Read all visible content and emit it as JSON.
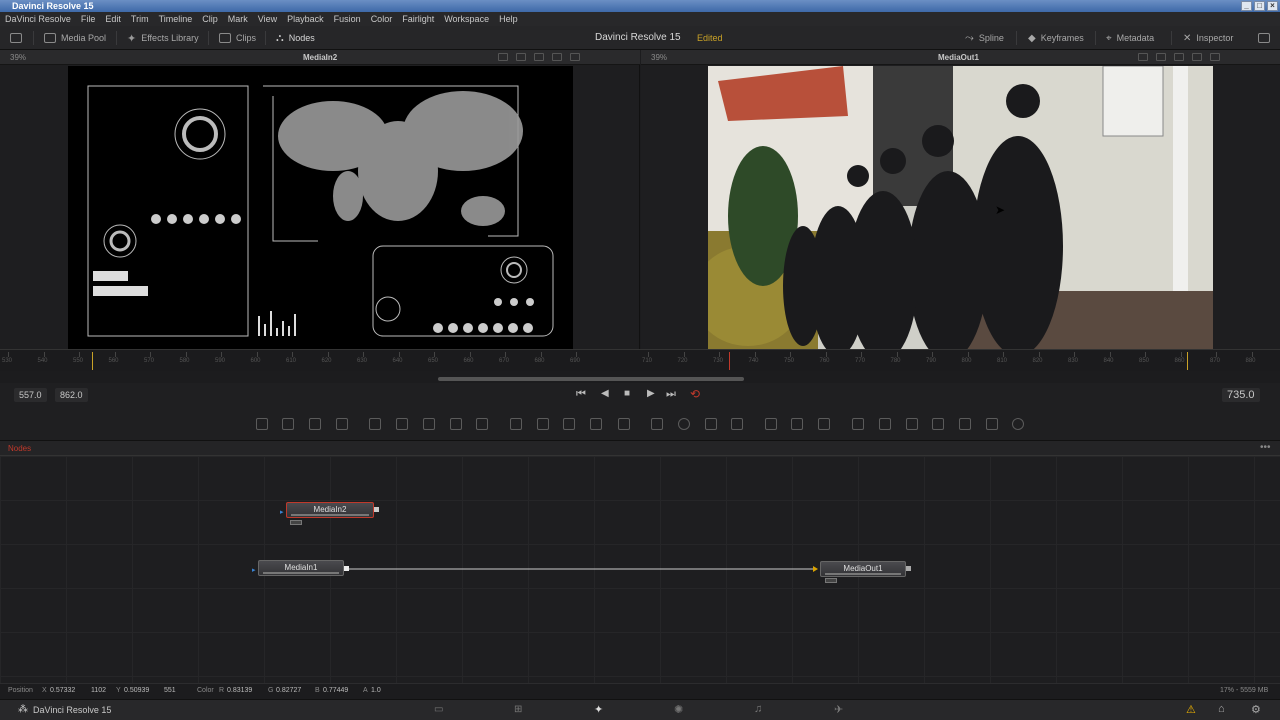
{
  "window": {
    "title": "Davinci Resolve 15"
  },
  "menu": [
    "DaVinci Resolve",
    "File",
    "Edit",
    "Trim",
    "Timeline",
    "Clip",
    "Mark",
    "View",
    "Playback",
    "Fusion",
    "Color",
    "Fairlight",
    "Workspace",
    "Help"
  ],
  "toolbar": {
    "media_pool": "Media Pool",
    "effects_library": "Effects Library",
    "clips": "Clips",
    "nodes": "Nodes",
    "project_title": "Davinci Resolve 15",
    "status": "Edited",
    "spline": "Spline",
    "keyframes": "Keyframes",
    "metadata": "Metadata",
    "inspector": "Inspector"
  },
  "viewers": {
    "left": {
      "zoom": "39%",
      "name": "MediaIn2"
    },
    "right": {
      "zoom": "39%",
      "name": "MediaOut1"
    }
  },
  "ruler": {
    "left_ticks": [
      "530",
      "540",
      "550",
      "560",
      "570",
      "580",
      "590",
      "600",
      "610",
      "620",
      "630",
      "640",
      "650",
      "660",
      "670",
      "680",
      "690"
    ],
    "right_ticks": [
      "710",
      "720",
      "730",
      "740",
      "750",
      "760",
      "770",
      "780",
      "790",
      "800",
      "810",
      "820",
      "830",
      "840",
      "850",
      "860",
      "870",
      "880"
    ]
  },
  "transport": {
    "start": "557.0",
    "end": "862.0",
    "current": "735.0"
  },
  "nodes_panel": {
    "title": "Nodes",
    "nodes": {
      "media_in2": "MediaIn2",
      "media_in1": "MediaIn1",
      "media_out1": "MediaOut1"
    }
  },
  "status": {
    "position_label": "Position",
    "x_label": "X",
    "x": "0.57332",
    "x_px": "1102",
    "y_label": "Y",
    "y": "0.50939",
    "y_px": "551",
    "color_label": "Color",
    "r_label": "R",
    "r": "0.83139",
    "g_label": "G",
    "g": "0.82727",
    "b_label": "B",
    "b": "0.77449",
    "a_label": "A",
    "a": "1.0",
    "memory": "17% - 5559 MB"
  },
  "pagebar": {
    "app_name": "DaVinci Resolve 15"
  },
  "colors": {
    "accent_red": "#c0392b",
    "edited_yellow": "#c9a227",
    "warning": "#f0b400"
  }
}
